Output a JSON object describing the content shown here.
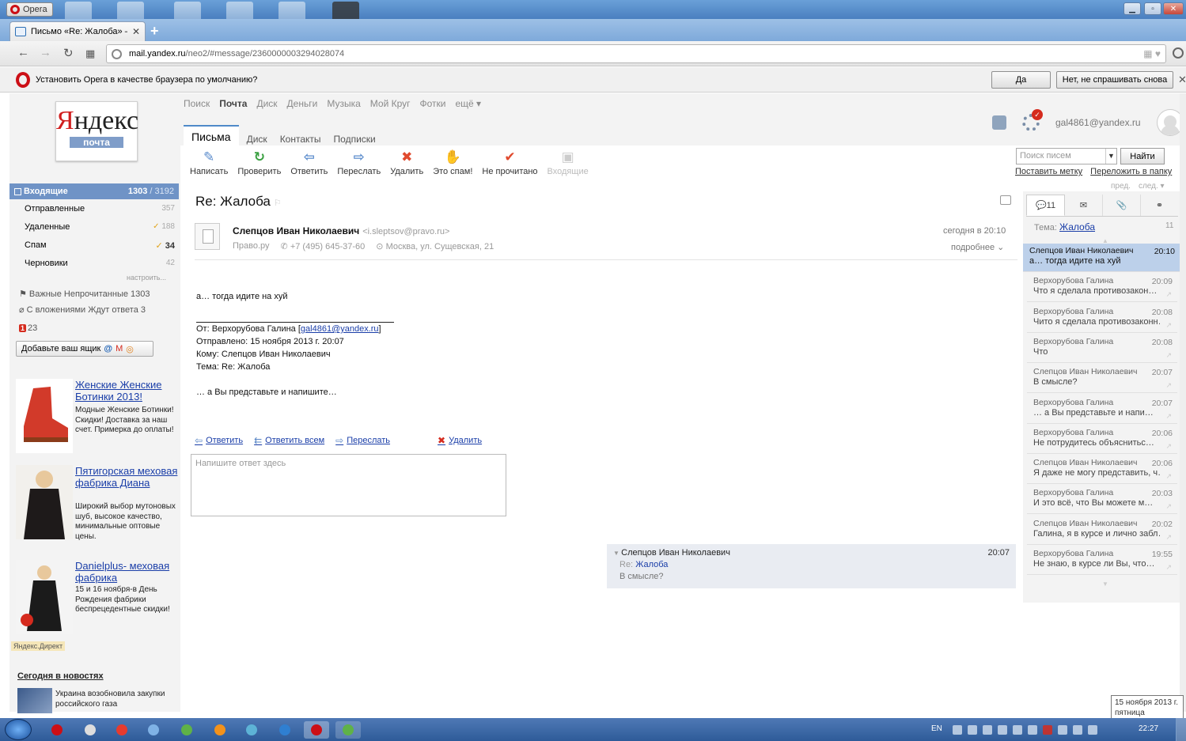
{
  "browser": {
    "menu_label": "Opera",
    "tab_title": "Письмо «Re: Жалоба» —",
    "url_domain": "mail.yandex.ru",
    "url_path": "/neo2/#message/2360000003294028074",
    "default_prompt": "Установить Opera в качестве браузера по умолчанию?",
    "yes_label": "Да",
    "no_label": "Нет, не спрашивать снова"
  },
  "yandex": {
    "logo_prefix": "Я",
    "logo_rest": "ндекс",
    "logo_sub": "почта",
    "top_nav": [
      "Поиск",
      "Почта",
      "Диск",
      "Деньги",
      "Музыка",
      "Мой Круг",
      "Фотки",
      "ещё ▾"
    ],
    "sub_tabs": [
      "Письма",
      "Диск",
      "Контакты",
      "Подписки"
    ],
    "user_email": "gal4861@yandex.ru"
  },
  "toolbar": [
    {
      "label": "Написать",
      "icon": "compose-icon",
      "glyph": "✎",
      "color": "#5b8ccc"
    },
    {
      "label": "Проверить",
      "icon": "refresh-icon",
      "glyph": "↻",
      "color": "#3aa041"
    },
    {
      "label": "Ответить",
      "icon": "reply-icon",
      "glyph": "⇦",
      "color": "#5b8ccc"
    },
    {
      "label": "Переслать",
      "icon": "forward-icon",
      "glyph": "⇨",
      "color": "#5b8ccc"
    },
    {
      "label": "Удалить",
      "icon": "delete-icon",
      "glyph": "✖",
      "color": "#e04a2e"
    },
    {
      "label": "Это спам!",
      "icon": "spam-icon",
      "glyph": "✋",
      "color": "#f0a21a"
    },
    {
      "label": "Не прочитано",
      "icon": "unread-icon",
      "glyph": "✔",
      "color": "#e04a2e"
    },
    {
      "label": "Входящие",
      "icon": "folder-icon",
      "glyph": "▣",
      "color": "#cccccc"
    }
  ],
  "search": {
    "placeholder": "Поиск писем",
    "button": "Найти",
    "set_label": "Поставить метку",
    "move_folder": "Переложить в папку",
    "prev": "пред.",
    "next": "след. ▾"
  },
  "folders": {
    "inbox_label": "Входящие",
    "inbox_unread": "1303",
    "inbox_total": " / 3192",
    "items": [
      {
        "label": "Отправленные",
        "count": "357",
        "bold": false
      },
      {
        "label": "Удаленные",
        "count": "188",
        "bold": false
      },
      {
        "label": "Спам",
        "count": "34",
        "bold": true
      },
      {
        "label": "Черновики",
        "count": "42",
        "bold": false
      }
    ],
    "settings_link": "настроить...",
    "labels_line1": "⚑ Важные   Непрочитанные 1303",
    "labels_line2": "⌀ С вложениями   Ждут ответа 3",
    "badge_num": "1",
    "badge_rest": "23",
    "add_box": "Добавьте ваш ящик"
  },
  "ads": [
    {
      "title": "Женские Женские Ботинки 2013!",
      "desc": "Модные Женские Ботинки! Скидки! Доставка за наш счет. Примерка до оплаты!"
    },
    {
      "title": "Пятигорская меховая фабрика Диана",
      "desc": "Широкий выбор мутоновых шуб, высокое качество, минимальные оптовые цены."
    },
    {
      "title": "Danielplus- меховая фабрика",
      "desc": "15 и 16 ноября-в День Рождения фабрики беспрецедентные скидки!"
    }
  ],
  "direct_label": "Яндекс.Директ",
  "news": {
    "heading": "Сегодня в новостях",
    "item": "Украина возобновила закупки российского газа"
  },
  "message": {
    "subject": "Re: Жалоба",
    "sender_name": "Слепцов Иван Николаевич",
    "sender_email": "<i.sleptsov@pravo.ru>",
    "org": "Право.ру",
    "phone": "+7 (495) 645-37-60",
    "address": "Москва, ул. Сущевская, 21",
    "date": "сегодня в 20:10",
    "more": "подробнее",
    "body_line": "а… тогда идите на хуй",
    "quote_from_prefix": "От: Верхорубова Галина [",
    "quote_from_link": "gal4861@yandex.ru",
    "quote_from_suffix": "]",
    "quote_sent": "Отправлено: 15 ноября 2013 г. 20:07",
    "quote_to": "Кому: Слепцов Иван Николаевич",
    "quote_subject": "Тема: Re: Жалоба",
    "quote_body": "… а Вы представьте и напишите…",
    "reply": "Ответить",
    "reply_all": "Ответить всем",
    "forward": "Переслать",
    "delete": "Удалить",
    "reply_placeholder": "Напишите ответ здесь"
  },
  "previous": {
    "name": "Слепцов Иван Николаевич",
    "time": "20:07",
    "subject_prefix": "Re:",
    "subject_link": "Жалоба",
    "body": "В смысле?"
  },
  "thread": {
    "count_tab": "11",
    "topic_label": "Тема:",
    "topic": "Жалоба",
    "count": "11",
    "items": [
      {
        "from": "Слепцов Иван Николаевич",
        "time": "20:10",
        "snippet": "а… тогда идите на хуй",
        "selected": true
      },
      {
        "from": "Верхорубова Галина",
        "time": "20:09",
        "snippet": "Что я сделала противозакон…",
        "selected": false
      },
      {
        "from": "Верхорубова Галина",
        "time": "20:08",
        "snippet": "Чито я сделала противозаконн…",
        "selected": false
      },
      {
        "from": "Верхорубова Галина",
        "time": "20:08",
        "snippet": "Что",
        "selected": false
      },
      {
        "from": "Слепцов Иван Николаевич",
        "time": "20:07",
        "snippet": "В смысле?",
        "selected": false
      },
      {
        "from": "Верхорубова Галина",
        "time": "20:07",
        "snippet": "… а Вы представьте и напи…",
        "selected": false
      },
      {
        "from": "Верхорубова Галина",
        "time": "20:06",
        "snippet": "Не потрудитесь объяснитьс…",
        "selected": false
      },
      {
        "from": "Слепцов Иван Николаевич",
        "time": "20:06",
        "snippet": "Я даже не могу представить, ч…",
        "selected": false
      },
      {
        "from": "Верхорубова Галина",
        "time": "20:03",
        "snippet": "И это всё, что Вы можете м…",
        "selected": false
      },
      {
        "from": "Слепцов Иван Николаевич",
        "time": "20:02",
        "snippet": "Галина, я в курсе и лично забл…",
        "selected": false
      },
      {
        "from": "Верхорубова Галина",
        "time": "19:55",
        "snippet": "Не знаю, в курсе ли Вы, что…",
        "selected": false
      }
    ]
  },
  "system": {
    "date_tip_1": "15 ноября 2013 г.",
    "date_tip_2": "пятница",
    "lang": "EN",
    "clock": "22:27"
  }
}
